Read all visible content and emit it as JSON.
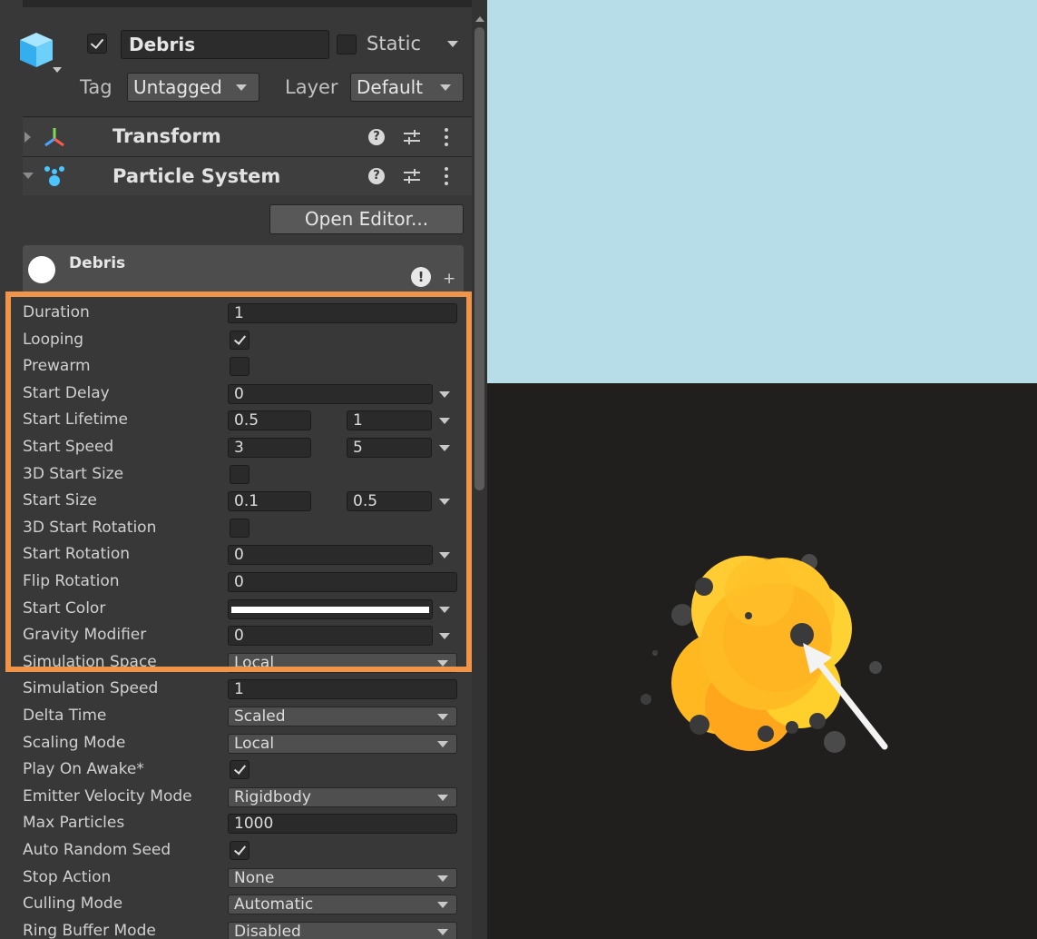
{
  "object": {
    "name": "Debris",
    "active": true,
    "static_label": "Static",
    "static": false,
    "tag_label": "Tag",
    "tag_value": "Untagged",
    "layer_label": "Layer",
    "layer_value": "Default",
    "icon": "cube-icon"
  },
  "components": {
    "transform": {
      "label": "Transform",
      "icon": "transform-axes-icon"
    },
    "particle_system": {
      "label": "Particle System",
      "icon": "particle-system-icon"
    },
    "help_icon": "question-icon",
    "presets_icon": "sliders-icon",
    "menu_icon": "kebab-menu-icon"
  },
  "open_editor_label": "Open Editor...",
  "module": {
    "name": "Debris",
    "icon": "circle-icon",
    "warning_icon": "warning-icon",
    "add_icon": "plus-icon"
  },
  "properties": [
    {
      "label": "Duration",
      "kind": "field",
      "v1": "1"
    },
    {
      "label": "Looping",
      "kind": "check",
      "checked": true
    },
    {
      "label": "Prewarm",
      "kind": "check",
      "checked": false
    },
    {
      "label": "Start Delay",
      "kind": "field-caret",
      "v1": "0"
    },
    {
      "label": "Start Lifetime",
      "kind": "two-caret",
      "v1": "0.5",
      "v2": "1"
    },
    {
      "label": "Start Speed",
      "kind": "two-caret",
      "v1": "3",
      "v2": "5"
    },
    {
      "label": "3D Start Size",
      "kind": "check",
      "checked": false
    },
    {
      "label": "Start Size",
      "kind": "two-caret",
      "v1": "0.1",
      "v2": "0.5"
    },
    {
      "label": "3D Start Rotation",
      "kind": "check",
      "checked": false
    },
    {
      "label": "Start Rotation",
      "kind": "field-caret",
      "v1": "0"
    },
    {
      "label": "Flip Rotation",
      "kind": "field",
      "v1": "0"
    },
    {
      "label": "Start Color",
      "kind": "color-caret",
      "color": "#ffffff"
    },
    {
      "label": "Gravity Modifier",
      "kind": "field-caret",
      "v1": "0"
    },
    {
      "label": "Simulation Space",
      "kind": "dropdown",
      "v1": "Local"
    },
    {
      "label": "Simulation Speed",
      "kind": "field",
      "v1": "1"
    },
    {
      "label": "Delta Time",
      "kind": "dropdown",
      "v1": "Scaled"
    },
    {
      "label": "Scaling Mode",
      "kind": "dropdown",
      "v1": "Local"
    },
    {
      "label": "Play On Awake*",
      "kind": "check",
      "checked": true
    },
    {
      "label": "Emitter Velocity Mode",
      "kind": "dropdown",
      "v1": "Rigidbody"
    },
    {
      "label": "Max Particles",
      "kind": "field",
      "v1": "1000"
    },
    {
      "label": "Auto Random Seed",
      "kind": "check",
      "checked": true
    },
    {
      "label": "Stop Action",
      "kind": "dropdown",
      "v1": "None"
    },
    {
      "label": "Culling Mode",
      "kind": "dropdown",
      "v1": "Automatic"
    },
    {
      "label": "Ring Buffer Mode",
      "kind": "dropdown",
      "v1": "Disabled"
    }
  ],
  "colors": {
    "highlight": "#f0944a",
    "background": "#b7dde8",
    "scene_background": "#201f1d",
    "explosion": "#ffc22a",
    "debris": "#3a3a3a"
  },
  "scene": {
    "content": "particle explosion with debris particles",
    "arrow_icon": "pointer-arrow-icon"
  }
}
